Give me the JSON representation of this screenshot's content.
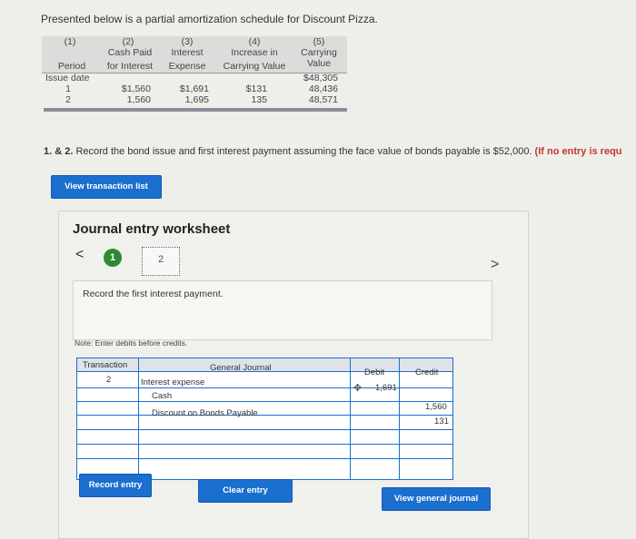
{
  "intro": "Presented below is a partial amortization schedule for Discount Pizza.",
  "schedule": {
    "columns": [
      {
        "num": "(1)",
        "line1": "",
        "line2": "Period"
      },
      {
        "num": "(2)",
        "line1": "Cash Paid",
        "line2": "for Interest"
      },
      {
        "num": "(3)",
        "line1": "Interest",
        "line2": "Expense"
      },
      {
        "num": "(4)",
        "line1": "Increase in",
        "line2": "Carrying Value"
      },
      {
        "num": "(5)",
        "line1": "Carrying",
        "line2": "Value"
      }
    ],
    "rows": [
      {
        "period": "Issue date",
        "cash": "",
        "interest": "",
        "increase": "",
        "carrying": "$48,305"
      },
      {
        "period": "1",
        "cash": "$1,560",
        "interest": "$1,691",
        "increase": "$131",
        "carrying": "48,436"
      },
      {
        "period": "2",
        "cash": "1,560",
        "interest": "1,695",
        "increase": "135",
        "carrying": "48,571"
      }
    ]
  },
  "question": {
    "prefix": "1. & 2.",
    "text": " Record the bond issue and first interest payment assuming the face value of bonds payable is $52,000.",
    "warning": " (If no entry is requ"
  },
  "view_transaction_list": "View transaction list",
  "worksheet": {
    "title": "Journal entry worksheet",
    "prev_arrow": "<",
    "next_arrow": ">",
    "steps": [
      "1",
      "2"
    ],
    "instruction": "Record the first interest payment.",
    "note": "Note: Enter debits before credits."
  },
  "journal": {
    "headers": {
      "transaction": "Transaction",
      "general_journal": "General Journal",
      "debit": "Debit",
      "credit": "Credit"
    },
    "transaction_no": "2",
    "entries": [
      {
        "account": "Interest expense",
        "debit": "1,691",
        "credit": ""
      },
      {
        "account": "Cash",
        "debit": "",
        "credit": "1,560"
      },
      {
        "account": "Discount on Bonds Payable",
        "debit": "",
        "credit": "131"
      }
    ]
  },
  "buttons": {
    "record": "Record entry",
    "clear": "Clear entry",
    "view_journal": "View general journal"
  },
  "colors": {
    "primary_blue": "#1a6fcf",
    "step_green": "#2e8a32",
    "warning_red": "#c0392b"
  }
}
